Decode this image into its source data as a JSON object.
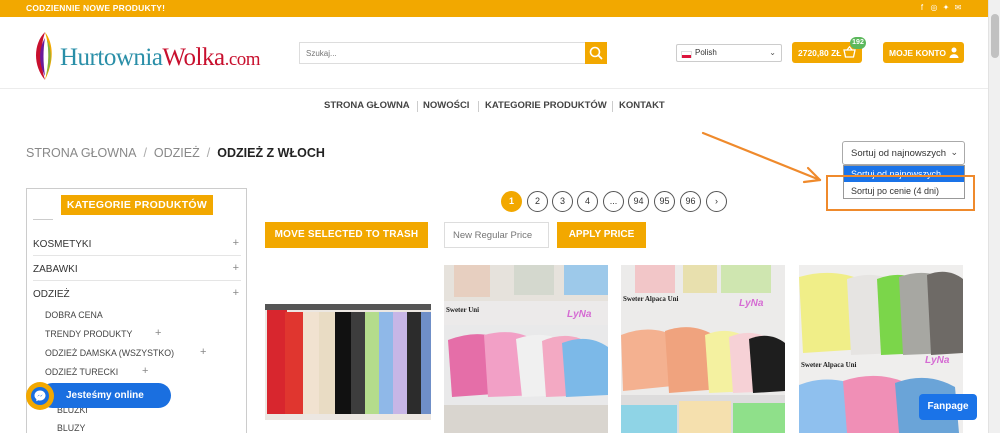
{
  "topbar": {
    "message": "CODZIENNIE NOWE PRODUKTY!",
    "social_icons": [
      "facebook-icon",
      "instagram-icon",
      "twitter-icon",
      "email-icon"
    ]
  },
  "header": {
    "logo": {
      "part1": "Hurtownia",
      "part2": "Wolka",
      "part3": ".com"
    },
    "search_placeholder": "Szukaj...",
    "language": "Polish",
    "cart_total": "2720,80 ZŁ",
    "cart_count": "192",
    "account_label": "MOJE KONTO"
  },
  "nav": {
    "items": [
      "STRONA GŁOWNA",
      "NOWOŚCI",
      "KATEGORIE PRODUKTÓW",
      "KONTAKT"
    ]
  },
  "breadcrumb": {
    "items": [
      "STRONA GŁOWNA",
      "ODZIEŻ"
    ],
    "current": "ODZIEŻ Z WŁOCH"
  },
  "sort": {
    "selected": "Sortuj od najnowszych",
    "options": [
      "Sortuj od najnowszych",
      "Sortuj po cenie (4 dni)"
    ]
  },
  "sidebar": {
    "title": "KATEGORIE PRODUKTÓW",
    "categories": [
      "KOSMETYKI",
      "ZABAWKI",
      "ODZIEŻ"
    ],
    "subcategories": [
      "DOBRA CENA",
      "TRENDY PRODUKTY",
      "ODZIEŻ DAMSKA (WSZYSTKO)",
      "ODZIEŻ TURECKI",
      "BLUZKI",
      "BLUZY"
    ]
  },
  "pagination": {
    "pages": [
      "1",
      "2",
      "3",
      "4",
      "...",
      "94",
      "95",
      "96",
      "›"
    ],
    "current": "1"
  },
  "actions": {
    "trash_label": "MOVE SELECTED TO TRASH",
    "price_placeholder": "New Regular Price",
    "apply_label": "APPLY PRICE"
  },
  "products": [
    {
      "caption": ""
    },
    {
      "caption": "Sweter Uni",
      "brand": "LyNa"
    },
    {
      "caption": "Sweter Alpaca Uni",
      "brand": "LyNa"
    },
    {
      "caption": "Sweter Alpaca Uni",
      "brand": "LyNa"
    }
  ],
  "widgets": {
    "chat_label": "Jesteśmy online",
    "fanpage_label": "Fanpage"
  },
  "colors": {
    "accent": "#f2a800",
    "annotation": "#ef8a2c",
    "chat_blue": "#1a6fe0",
    "highlight_blue": "#1a73e8"
  }
}
